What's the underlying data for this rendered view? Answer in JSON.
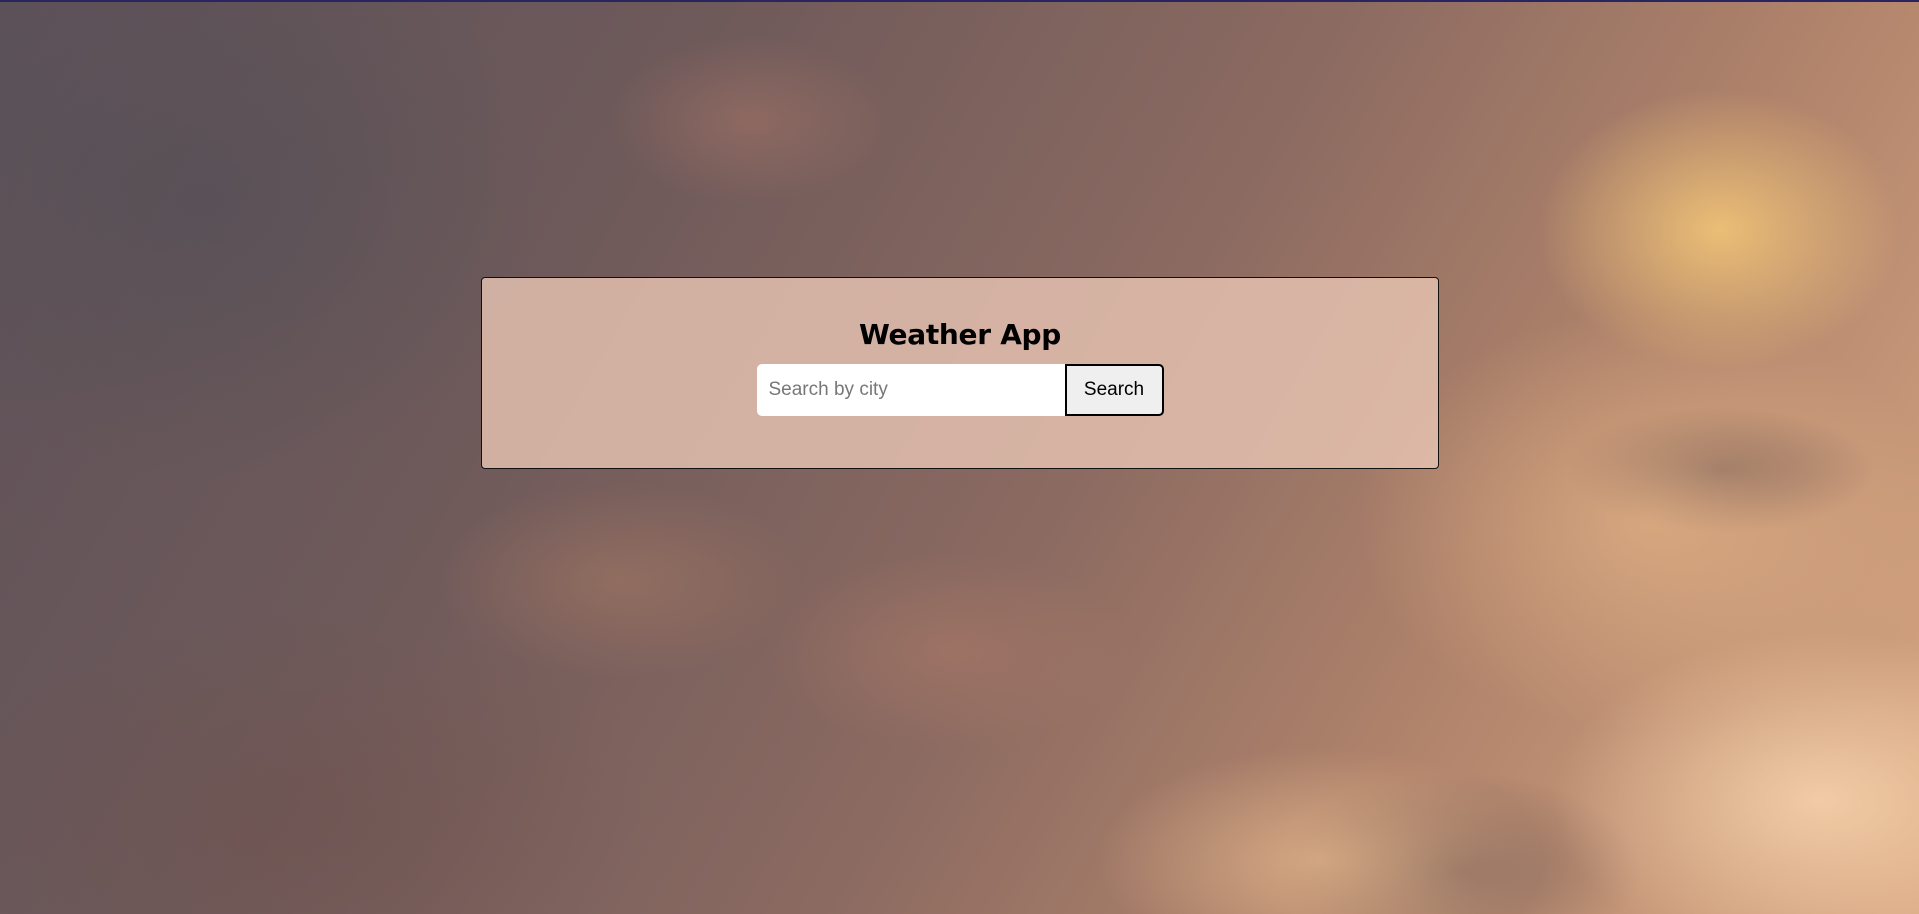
{
  "app": {
    "title": "Weather App"
  },
  "search": {
    "value": "",
    "placeholder": "Search by city",
    "button_label": "Search"
  }
}
